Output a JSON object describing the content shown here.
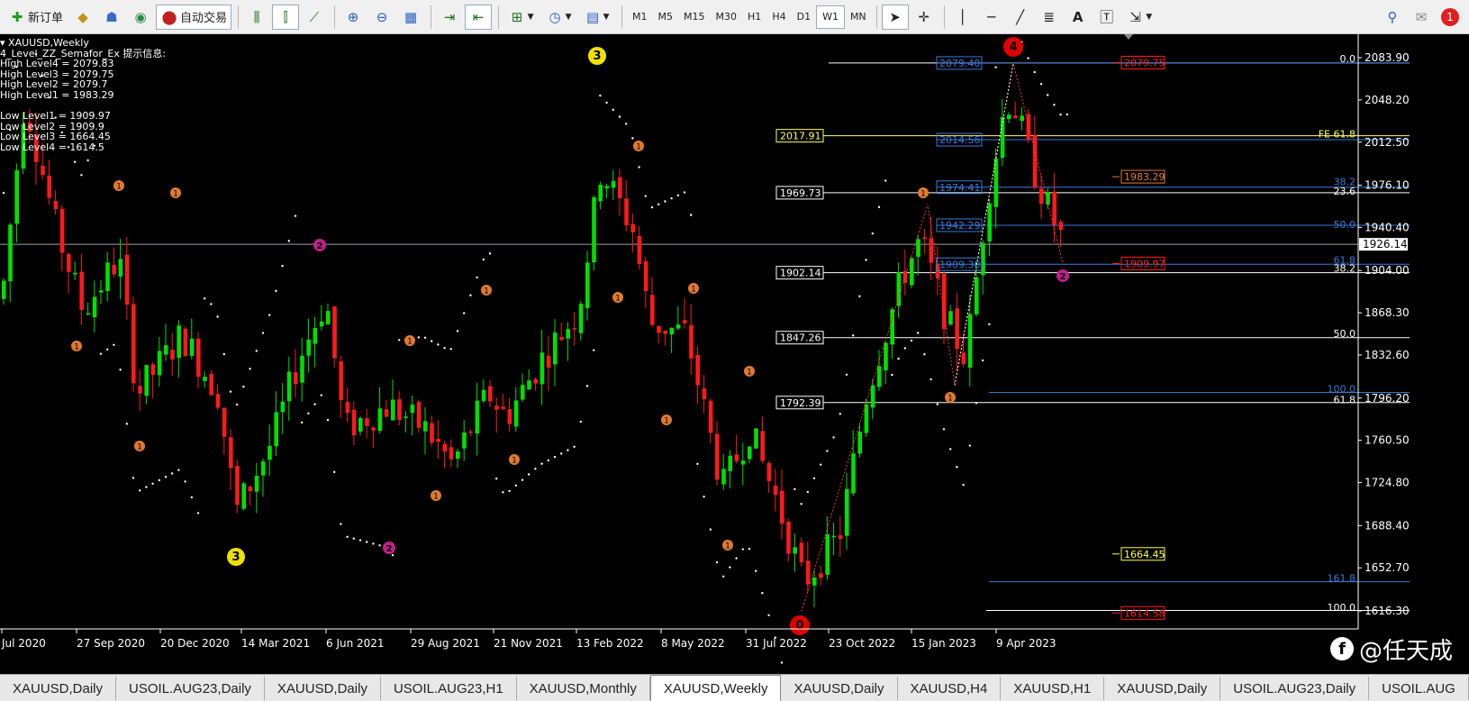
{
  "toolbar": {
    "new_order": "新订单",
    "auto_trade": "自动交易",
    "timeframes": [
      "M1",
      "M5",
      "M15",
      "M30",
      "H1",
      "H4",
      "D1",
      "W1",
      "MN"
    ],
    "active_timeframe": "W1",
    "alert_count": "1"
  },
  "info": {
    "symbol": "XAUUSD,Weekly",
    "indicator": "4_Level_ZZ_Semafor_Ex 提示信息:",
    "high_levels": [
      "High Level4 = 2079.83",
      "High Level3 = 2079.75",
      "High Level2 = 2079.7",
      "High Level1 = 1983.29"
    ],
    "low_levels": [
      "Low Level1 = 1909.97",
      "Low Level2 = 1909.9",
      "Low Level3 = 1664.45",
      "Low Level4 = 1614.5"
    ]
  },
  "price_axis": [
    "2083.90",
    "2048.20",
    "2012.50",
    "1976.10",
    "1940.40",
    "1904.00",
    "1868.30",
    "1832.60",
    "1796.20",
    "1760.50",
    "1724.80",
    "1688.40",
    "1652.70",
    "1616.30"
  ],
  "current_price": "1926.14",
  "time_axis": [
    "Jul 2020",
    "27 Sep 2020",
    "20 Dec 2020",
    "14 Mar 2021",
    "6 Jun 2021",
    "29 Aug 2021",
    "21 Nov 2021",
    "13 Feb 2022",
    "8 May 2022",
    "31 Jul 2022",
    "23 Oct 2022",
    "15 Jan 2023",
    "9 Apr 2023"
  ],
  "fibo_left_labels": [
    "2017.91",
    "1969.73",
    "1902.14",
    "1847.26",
    "1792.39"
  ],
  "fibo_blue_labels": [
    "2079.40",
    "2014.56",
    "1974.41",
    "1942.29",
    "1909.30"
  ],
  "fibo_red_labels": [
    "2079.75",
    "1909.97",
    "1614.58"
  ],
  "fibo_orange_labels": [
    "1983.29"
  ],
  "fibo_yellow_label": "1664.45",
  "fibo_right_labels": [
    "0.0",
    "FE 61.8",
    "23.6",
    "38.2",
    "50.0",
    "61.8",
    "38.2",
    "50.0",
    "100.0",
    "61.8",
    "161.8",
    "100.0"
  ],
  "semafor_markers": [
    "4",
    "3",
    "3",
    "2",
    "2",
    "1",
    "0"
  ],
  "tabs": [
    "XAUUSD,Daily",
    "USOIL.AUG23,Daily",
    "XAUUSD,Daily",
    "USOIL.AUG23,H1",
    "XAUUSD,Monthly",
    "XAUUSD,Weekly",
    "XAUUSD,Daily",
    "XAUUSD,H4",
    "XAUUSD,H1",
    "XAUUSD,Daily",
    "USOIL.AUG23,Daily",
    "USOIL.AUG"
  ],
  "active_tab": "XAUUSD,Weekly",
  "watermark": "@任天成",
  "colors": {
    "bull": "#00e000",
    "bear": "#ff1a1a",
    "fibo_blue": "#3a78d8",
    "grid_white": "#ffffff"
  }
}
